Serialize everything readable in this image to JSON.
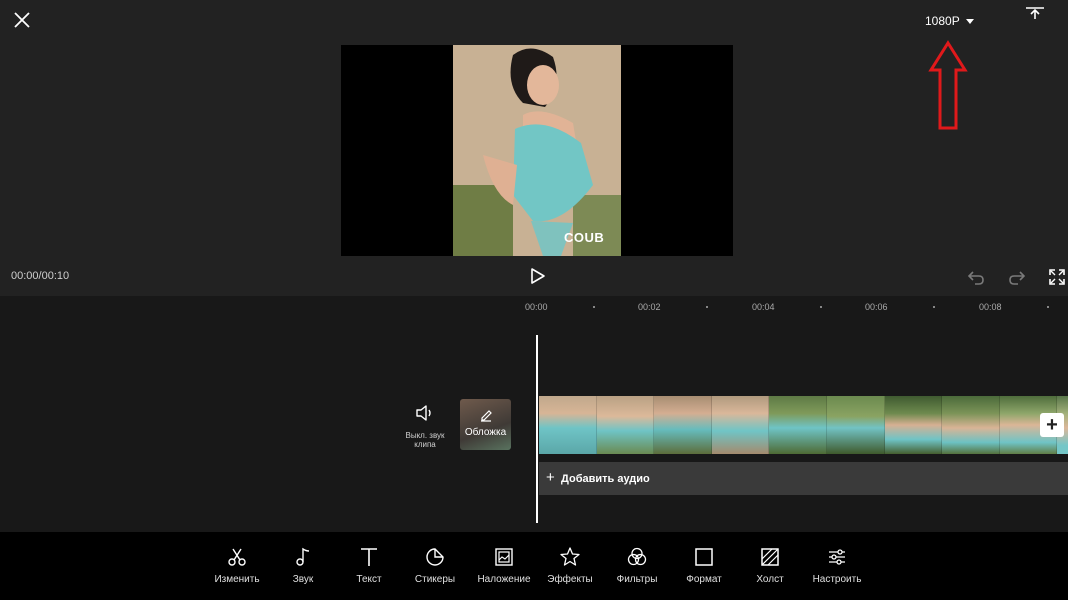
{
  "header": {
    "resolution_label": "1080P"
  },
  "preview": {
    "watermark": "COUB"
  },
  "playback": {
    "time_text": "00:00/00:10"
  },
  "timeline": {
    "ticks": [
      "00:00",
      "00:02",
      "00:04",
      "00:06",
      "00:08"
    ],
    "mute_label": "Выкл. звук клипа",
    "cover_label": "Обложка",
    "add_audio_label": "Добавить аудио"
  },
  "toolbar": {
    "items": [
      {
        "label": "Изменить",
        "icon": "scissors-icon"
      },
      {
        "label": "Звук",
        "icon": "music-note-icon"
      },
      {
        "label": "Текст",
        "icon": "text-icon"
      },
      {
        "label": "Стикеры",
        "icon": "sticker-icon"
      },
      {
        "label": "Наложение",
        "icon": "overlay-icon"
      },
      {
        "label": "Эффекты",
        "icon": "effects-icon"
      },
      {
        "label": "Фильтры",
        "icon": "filters-icon"
      },
      {
        "label": "Формат",
        "icon": "format-icon"
      },
      {
        "label": "Холст",
        "icon": "canvas-icon"
      },
      {
        "label": "Настроить",
        "icon": "adjust-icon"
      }
    ]
  },
  "colors": {
    "annotation_arrow": "#e0191b",
    "background": "#222222",
    "toolbar_bg": "#000000",
    "clip_accent": "#6fc4c6"
  }
}
